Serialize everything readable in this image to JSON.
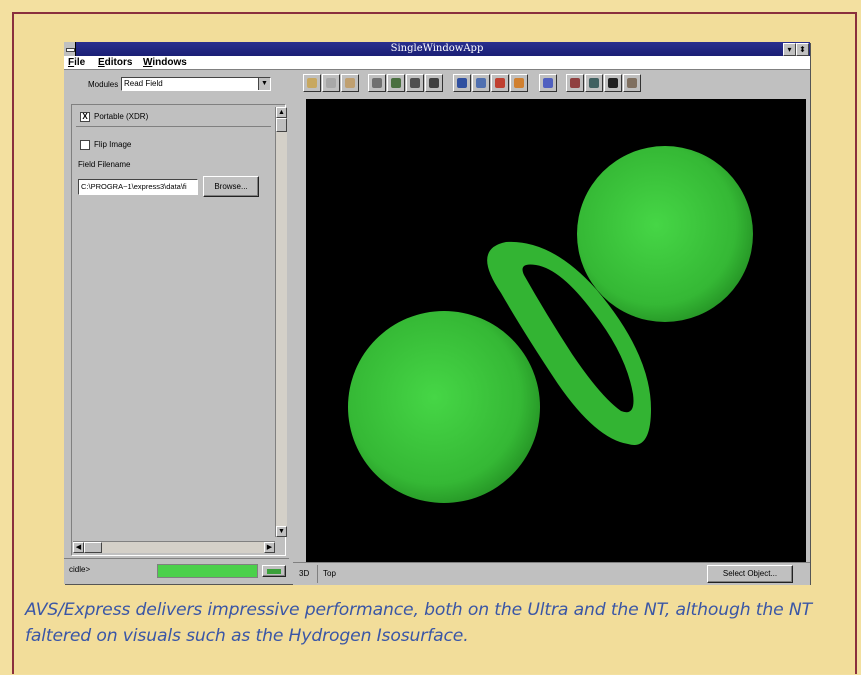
{
  "window": {
    "title": "SingleWindowApp"
  },
  "menu": [
    {
      "label": "File",
      "underline": "F",
      "rest": "ile"
    },
    {
      "label": "Editors",
      "underline": "E",
      "rest": "ditors"
    },
    {
      "label": "Windows",
      "underline": "W",
      "rest": "indows"
    }
  ],
  "panel": {
    "modules_label": "Modules",
    "modules_value": "Read Field",
    "portable_label": "Portable (XDR)",
    "portable_checked": "X",
    "flip_label": "Flip Image",
    "filename_label": "Field Filename",
    "filename_value": "C:\\PROGRA~1\\express3\\data\\fi",
    "browse_label": "Browse..."
  },
  "status": {
    "text": "cidle>",
    "progress": 1.0
  },
  "viewer": {
    "mode_3d": "3D",
    "view_top": "Top",
    "select_object_label": "Select Object...",
    "object_color": "#37c237"
  },
  "caption": "AVS/Express delivers impressive performance, both on the Ultra and the NT, although the NT faltered on visuals such as the Hydrogen Isosurface.",
  "toolbar_icons": [
    "camera-icon",
    "camera2-icon",
    "person-icon",
    "rotate-icon",
    "scale-icon",
    "zoom-icon",
    "translate-icon",
    "cube-blue-icon",
    "cube-gray-icon",
    "cube-red-icon",
    "cube-orange-icon",
    "light-icon",
    "print-icon",
    "window-icon",
    "film-icon",
    "car-icon"
  ]
}
